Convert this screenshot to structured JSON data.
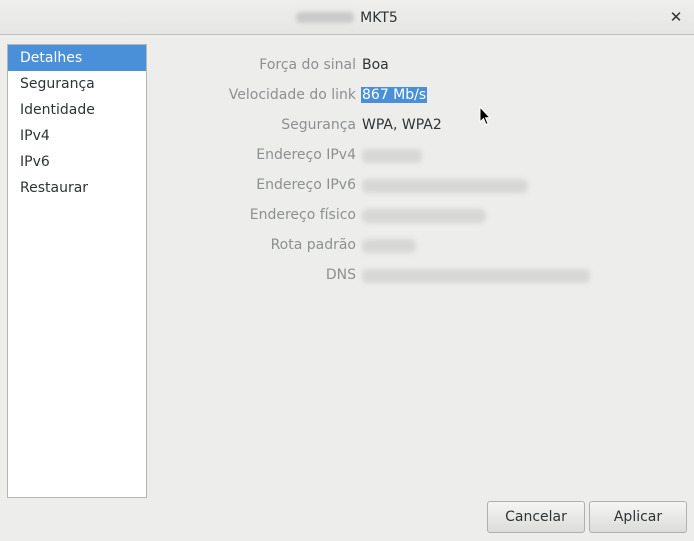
{
  "window": {
    "title": "MKT5",
    "close_glyph": "✕"
  },
  "sidebar": {
    "items": [
      {
        "label": "Detalhes",
        "selected": true
      },
      {
        "label": "Segurança",
        "selected": false
      },
      {
        "label": "Identidade",
        "selected": false
      },
      {
        "label": "IPv4",
        "selected": false
      },
      {
        "label": "IPv6",
        "selected": false
      },
      {
        "label": "Restaurar",
        "selected": false
      }
    ]
  },
  "details": {
    "signal_strength": {
      "label": "Força do sinal",
      "value": "Boa"
    },
    "link_speed": {
      "label": "Velocidade do link",
      "value": "867 Mb/s"
    },
    "security": {
      "label": "Segurança",
      "value": "WPA, WPA2"
    },
    "ipv4": {
      "label": "Endereço IPv4"
    },
    "ipv6": {
      "label": "Endereço IPv6"
    },
    "hw_address": {
      "label": "Endereço físico"
    },
    "default_route": {
      "label": "Rota padrão"
    },
    "dns": {
      "label": "DNS"
    }
  },
  "buttons": {
    "cancel": "Cancelar",
    "apply": "Aplicar"
  },
  "colors": {
    "selection": "#4a90d9",
    "window_bg": "#ededec",
    "label_gray": "#8d9091",
    "text": "#2e3436"
  },
  "icons": {
    "close": "close-icon",
    "pointer": "mouse-pointer-icon"
  }
}
